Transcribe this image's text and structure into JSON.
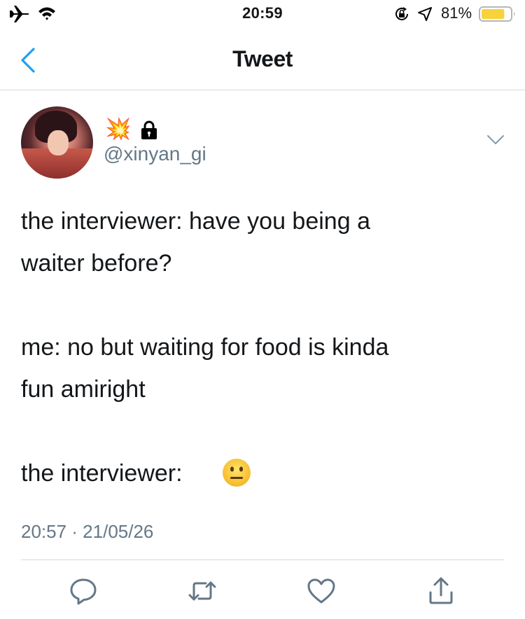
{
  "status_bar": {
    "time": "20:59",
    "battery_percent": "81%",
    "battery_level": 0.81,
    "icons": [
      "airplane-icon",
      "wifi-icon",
      "orientation-lock-icon",
      "location-arrow-icon",
      "battery-icon"
    ]
  },
  "nav": {
    "title": "Tweet",
    "back_icon": "chevron-left-icon"
  },
  "tweet": {
    "author": {
      "display_name_emoji": "💥",
      "protected_icon": "lock-icon",
      "handle": "@xinyan_gi"
    },
    "lines": [
      "the interviewer: have you being a",
      "waiter before?",
      "me: no but waiting for food is kinda",
      "fun amiright",
      "the interviewer:"
    ],
    "trailing_emoji": "neutral-face-emoji",
    "timestamp": "20:57 · 21/05/26",
    "more_icon": "chevron-down-icon"
  },
  "actions": [
    {
      "name": "reply",
      "icon": "reply-bubble-icon"
    },
    {
      "name": "retweet",
      "icon": "retweet-icon"
    },
    {
      "name": "like",
      "icon": "heart-icon"
    },
    {
      "name": "share",
      "icon": "share-icon"
    }
  ],
  "colors": {
    "accent_blue": "#1da1f2",
    "secondary_text": "#657786",
    "icon_gray": "#657786",
    "battery_yellow": "#f7d23a",
    "divider": "#d6d9dc"
  }
}
